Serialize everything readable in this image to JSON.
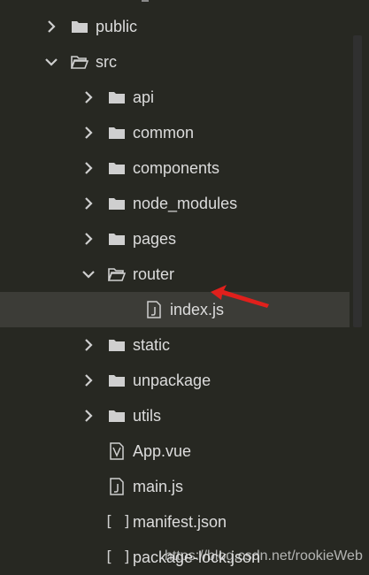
{
  "tree": {
    "items": [
      {
        "label": "public",
        "kind": "folder",
        "expanded": false,
        "depth": 1,
        "icon": "folder-icon"
      },
      {
        "label": "src",
        "kind": "folder",
        "expanded": true,
        "depth": 1,
        "icon": "folder-open-icon"
      },
      {
        "label": "api",
        "kind": "folder",
        "expanded": false,
        "depth": 2,
        "icon": "folder-icon"
      },
      {
        "label": "common",
        "kind": "folder",
        "expanded": false,
        "depth": 2,
        "icon": "folder-icon"
      },
      {
        "label": "components",
        "kind": "folder",
        "expanded": false,
        "depth": 2,
        "icon": "folder-icon"
      },
      {
        "label": "node_modules",
        "kind": "folder",
        "expanded": false,
        "depth": 2,
        "icon": "folder-icon"
      },
      {
        "label": "pages",
        "kind": "folder",
        "expanded": false,
        "depth": 2,
        "icon": "folder-icon"
      },
      {
        "label": "router",
        "kind": "folder",
        "expanded": true,
        "depth": 2,
        "icon": "folder-open-icon"
      },
      {
        "label": "index.js",
        "kind": "file",
        "depth": 3,
        "icon": "js-file-icon",
        "selected": true
      },
      {
        "label": "static",
        "kind": "folder",
        "expanded": false,
        "depth": 2,
        "icon": "folder-icon"
      },
      {
        "label": "unpackage",
        "kind": "folder",
        "expanded": false,
        "depth": 2,
        "icon": "folder-icon"
      },
      {
        "label": "utils",
        "kind": "folder",
        "expanded": false,
        "depth": 2,
        "icon": "folder-icon"
      },
      {
        "label": "App.vue",
        "kind": "file",
        "depth": 2,
        "icon": "vue-file-icon"
      },
      {
        "label": "main.js",
        "kind": "file",
        "depth": 2,
        "icon": "js-file-icon"
      },
      {
        "label": "manifest.json",
        "kind": "file",
        "depth": 2,
        "icon": "json-file-icon"
      },
      {
        "label": "package-lock.json",
        "kind": "file",
        "depth": 2,
        "icon": "json-file-icon"
      }
    ],
    "json_icon_glyph": "[ ]"
  },
  "annotation": {
    "arrow_color": "#e0201c",
    "icon": "red-arrow-icon"
  },
  "watermark": {
    "text": "https://blog.csdn.net/rookieWeb"
  },
  "colors": {
    "background": "#272822",
    "selected_row": "#3c3c37",
    "text": "#dcdcdc",
    "icon": "#cfcfcf"
  }
}
